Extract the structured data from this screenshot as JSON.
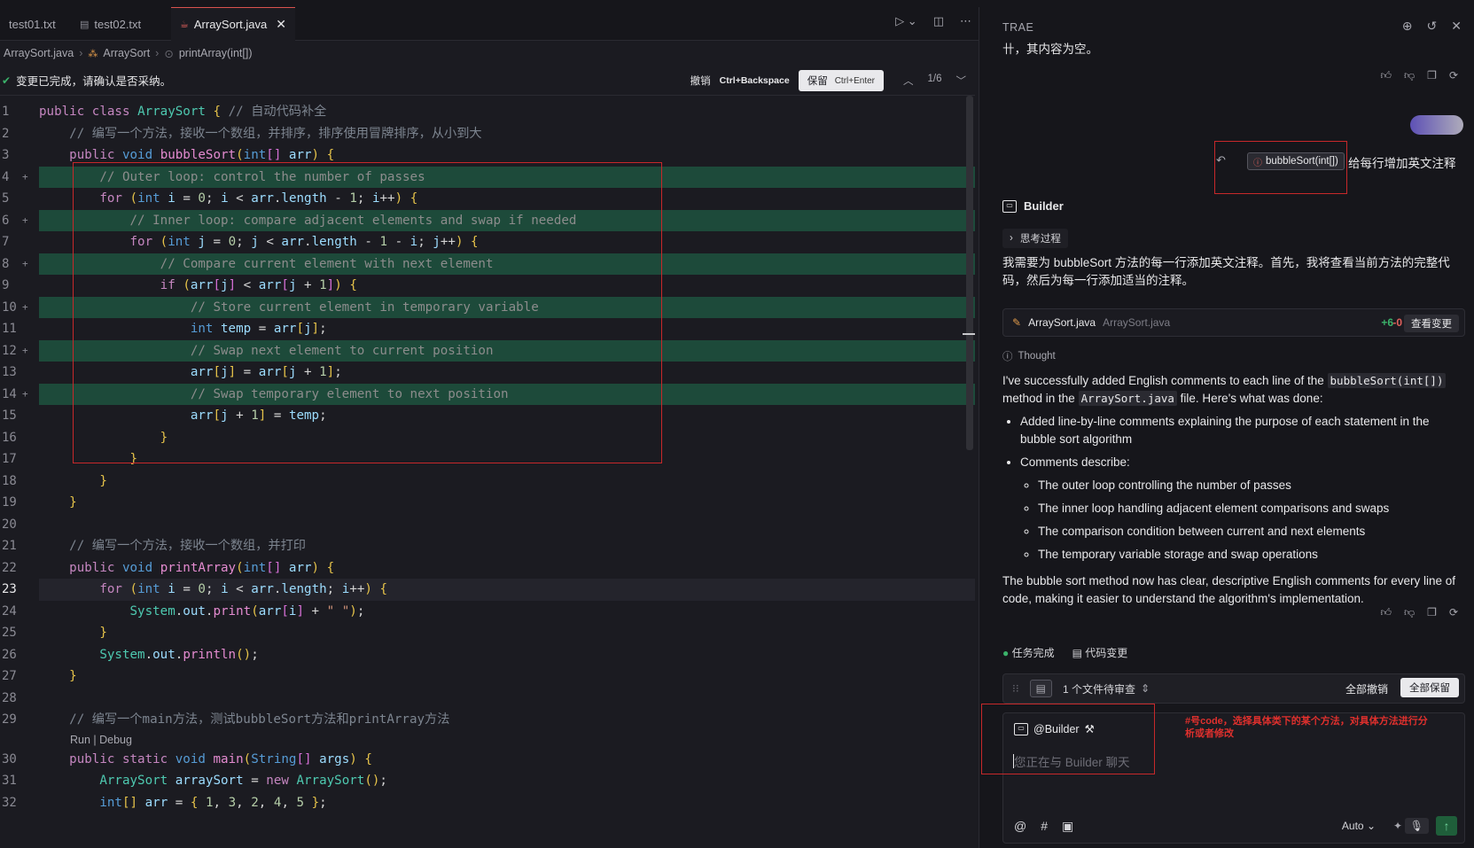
{
  "tabs": [
    {
      "label": "test01.txt",
      "active": false
    },
    {
      "label": "test02.txt",
      "active": false
    },
    {
      "label": "ArraySort.java",
      "active": true
    }
  ],
  "breadcrumb": [
    "ArraySort.java",
    "ArraySort",
    "printArray(int[])"
  ],
  "review_bar": {
    "message": "变更已完成，请确认是否采纳。",
    "undo_label": "撤销",
    "undo_key": "Ctrl+Backspace",
    "keep_label": "保留",
    "keep_key": "Ctrl+Enter",
    "counter": "1/6"
  },
  "code_lines": [
    {
      "n": "1",
      "added": false
    },
    {
      "n": "2",
      "added": false
    },
    {
      "n": "3",
      "added": false
    },
    {
      "n": "4",
      "added": true
    },
    {
      "n": "5",
      "added": false
    },
    {
      "n": "6",
      "added": true
    },
    {
      "n": "7",
      "added": false
    },
    {
      "n": "8",
      "added": true
    },
    {
      "n": "9",
      "added": false
    },
    {
      "n": "10",
      "added": true
    },
    {
      "n": "11",
      "added": false
    },
    {
      "n": "12",
      "added": true
    },
    {
      "n": "13",
      "added": false
    },
    {
      "n": "14",
      "added": true
    },
    {
      "n": "15",
      "added": false
    },
    {
      "n": "16",
      "added": false
    },
    {
      "n": "17",
      "added": false
    },
    {
      "n": "18",
      "added": false
    },
    {
      "n": "19",
      "added": false
    },
    {
      "n": "20",
      "added": false
    },
    {
      "n": "21",
      "added": false
    },
    {
      "n": "22",
      "added": false
    },
    {
      "n": "23",
      "added": false,
      "current": true
    },
    {
      "n": "24",
      "added": false
    },
    {
      "n": "25",
      "added": false
    },
    {
      "n": "26",
      "added": false
    },
    {
      "n": "27",
      "added": false
    },
    {
      "n": "28",
      "added": false
    },
    {
      "n": "29",
      "added": false
    },
    {
      "n": "30",
      "added": false
    },
    {
      "n": "31",
      "added": false
    },
    {
      "n": "32",
      "added": false
    }
  ],
  "code_text": [
    "public class ArraySort { // 自动代码补全",
    "    // 编写一个方法，接收一个数组，并排序，排序使用冒牌排序，从小到大",
    "    public void bubbleSort(int[] arr) {",
    "        // Outer loop: control the number of passes",
    "        for (int i = 0; i < arr.length - 1; i++) {",
    "            // Inner loop: compare adjacent elements and swap if needed",
    "            for (int j = 0; j < arr.length - 1 - i; j++) {",
    "                // Compare current element with next element",
    "                if (arr[j] < arr[j + 1]) {",
    "                    // Store current element in temporary variable",
    "                    int temp = arr[j];",
    "                    // Swap next element to current position",
    "                    arr[j] = arr[j + 1];",
    "                    // Swap temporary element to next position",
    "                    arr[j + 1] = temp;",
    "                }",
    "            }",
    "        }",
    "    }",
    "",
    "    // 编写一个方法，接收一个数组，并打印",
    "    public void printArray(int[] arr) {",
    "        for (int i = 0; i < arr.length; i++) {",
    "            System.out.print(arr[i] + \" \");",
    "        }",
    "        System.out.println();",
    "    }",
    "",
    "    // 编写一个main方法，测试bubbleSort方法和printArray方法",
    "    public static void main(String[] args) {",
    "        ArraySort arraySort = new ArraySort();",
    "        int[] arr = { 1, 3, 2, 4, 5 };"
  ],
  "codelens": "Run | Debug",
  "panel": {
    "title": "TRAE",
    "prev_text": "卄，其内容为空。",
    "context_chip": "bubbleSort(int[])",
    "user_message": "给每行增加英文注释",
    "agent_name": "Builder",
    "thinking_label": "思考过程",
    "intro": "我需要为 bubbleSort 方法的每一行添加英文注释。首先，我将查看当前方法的完整代码，然后为每一行添加适当的注释。",
    "file_card": {
      "name": "ArraySort.java",
      "path": "ArraySort.java",
      "added": "+6",
      "removed": "-0",
      "view_label": "查看变更"
    },
    "thought_label": "Thought",
    "answer": {
      "p1_a": "I've successfully added English comments to each line of the ",
      "p1_code1": "bubbleSort(int[])",
      "p1_b": " method in the ",
      "p1_code2": "ArraySort.java",
      "p1_c": " file. Here's what was done:",
      "b1": "Added line-by-line comments explaining the purpose of each statement in the bubble sort algorithm",
      "b2": "Comments describe:",
      "s1": "The outer loop controlling the number of passes",
      "s2": "The inner loop handling adjacent element comparisons and swaps",
      "s3": "The comparison condition between current and next elements",
      "s4": "The temporary variable storage and swap operations",
      "p2": "The bubble sort method now has clear, descriptive English comments for every line of code, making it easier to understand the algorithm's implementation."
    },
    "task_done": "任务完成",
    "code_changes": "代码变更",
    "pending_files": "1 个文件待审查",
    "undo_all": "全部撤销",
    "keep_all": "全部保留",
    "mention": "@Builder",
    "input_placeholder": "您正在与 Builder 聊天",
    "mode": "Auto",
    "annotation": "#号code，选择具体类下的某个方法，对具体方法进行分析或者修改"
  },
  "colors": {
    "accent_red": "#c7282a",
    "added_bg": "#1d4a3a",
    "ok_green": "#3bb26a"
  }
}
